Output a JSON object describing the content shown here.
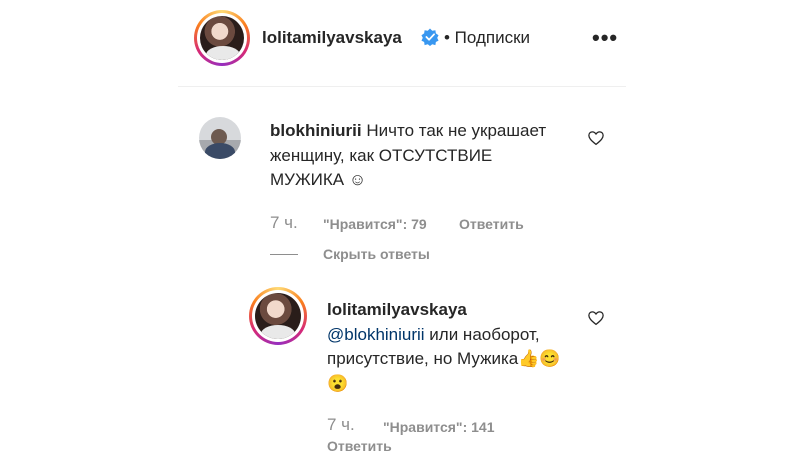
{
  "header": {
    "username": "lolitamilyavskaya",
    "follow_label": "• Подписки",
    "more_label": "•••"
  },
  "comment": {
    "username": "blokhiniurii",
    "text": "Ничто так не украшает женщину, как ОТСУТСТВИЕ МУЖИКА ☺",
    "time": "7 ч.",
    "likes": "\"Нравится\": 79",
    "reply_label": "Ответить",
    "hide_replies_label": "Скрыть ответы"
  },
  "reply": {
    "username": "lolitamilyavskaya",
    "mention": "@blokhiniurii",
    "text": " или наоборот, присутствие, но Мужика👍😊😮",
    "time": "7 ч.",
    "likes": "\"Нравится\": 141",
    "reply_label": "Ответить"
  },
  "colors": {
    "accent_link": "#003569",
    "verified_badge": "#3897f0",
    "muted_text": "#8e8e8e"
  },
  "icons": [
    "verified-icon",
    "more-options-icon",
    "heart-icon"
  ]
}
